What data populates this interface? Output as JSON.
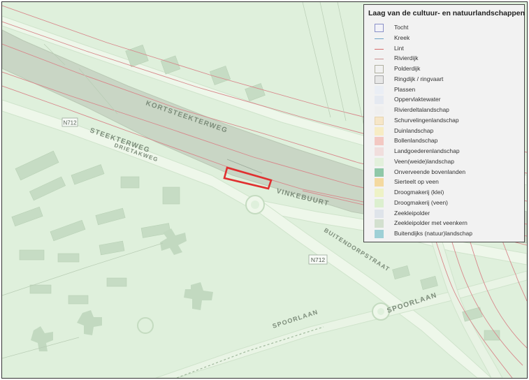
{
  "map": {
    "labels": {
      "kortsteekterweg": "KORTSTEEKTERWEG",
      "steekterweg": "STEEKTERWEG",
      "drietakweg": "DRIETAKWEG",
      "vinkebuurt": "VINKEBUURT",
      "buitendorpstraat": "BUITENDORPSTRAAT",
      "spoorlaan_left": "SPOORLAAN",
      "spoorlaan_right": "SPOORLAAN",
      "road_shield_top": "N712",
      "road_shield_mid": "N712"
    },
    "colors": {
      "background": "#dff0dc",
      "water_canal": "#c9d6c5",
      "road_fill": "#eef7ea",
      "building": "#c6dcc4",
      "red_line": "#d8868a",
      "parcel_outline": "#e03030"
    }
  },
  "legend": {
    "title": "Laag van de cultuur- en natuurlandschappen",
    "items": [
      {
        "label": "Tocht",
        "type": "box",
        "fill": "#f2f2f8",
        "border": "#8a90c8"
      },
      {
        "label": "Kreek",
        "type": "line",
        "color": "#6fa4c7"
      },
      {
        "label": "Lint",
        "type": "line",
        "color": "#d76a6a"
      },
      {
        "label": "Rivierdijk",
        "type": "line",
        "color": "#c98f8f"
      },
      {
        "label": "Polderdijk",
        "type": "box",
        "fill": "#f1f1f1",
        "border": "#b0b0a0"
      },
      {
        "label": "Ringdijk / ringvaart",
        "type": "box",
        "fill": "#e7e7e7",
        "border": "#a8a8a8"
      },
      {
        "label": "Plassen",
        "type": "box",
        "fill": "#eaeef5",
        "border": "#eaeef5"
      },
      {
        "label": "Oppervlaktewater",
        "type": "box",
        "fill": "#e5e9f1",
        "border": "#e5e9f1"
      },
      {
        "label": "Rivierdeltalandschap",
        "type": "box",
        "fill": "#efefef",
        "border": "#efefef"
      },
      {
        "label": "Schurvelingenlandschap",
        "type": "box",
        "fill": "#f6e6c8",
        "border": "#e6d4b0"
      },
      {
        "label": "Duinlandschap",
        "type": "box",
        "fill": "#f7ecc4",
        "border": "#f7ecc4"
      },
      {
        "label": "Bollenlandschap",
        "type": "box",
        "fill": "#f3c8c2",
        "border": "#f3c8c2"
      },
      {
        "label": "Landgoederenlandschap",
        "type": "box",
        "fill": "#f1dedd",
        "border": "#f1dedd"
      },
      {
        "label": "Veen(weide)landschap",
        "type": "box",
        "fill": "#e3f0dc",
        "border": "#e3f0dc"
      },
      {
        "label": "Onverveende bovenlanden",
        "type": "box",
        "fill": "#8fc8a8",
        "border": "#8fc8a8"
      },
      {
        "label": "Sierteelt op veen",
        "type": "box",
        "fill": "#f4d9a0",
        "border": "#f4d9a0"
      },
      {
        "label": "Droogmakerij (klei)",
        "type": "box",
        "fill": "#eef2c6",
        "border": "#eef2c6"
      },
      {
        "label": "Droogmakerij (veen)",
        "type": "box",
        "fill": "#dcefcf",
        "border": "#dcefcf"
      },
      {
        "label": "Zeekleipolder",
        "type": "box",
        "fill": "#dfe4ea",
        "border": "#dfe4ea"
      },
      {
        "label": "Zeekleipolder met veenkern",
        "type": "box",
        "fill": "#d3e0cf",
        "border": "#d3e0cf"
      },
      {
        "label": "Buitendijks (natuur)landschap",
        "type": "box",
        "fill": "#9ed0d6",
        "border": "#9ed0d6"
      }
    ]
  }
}
